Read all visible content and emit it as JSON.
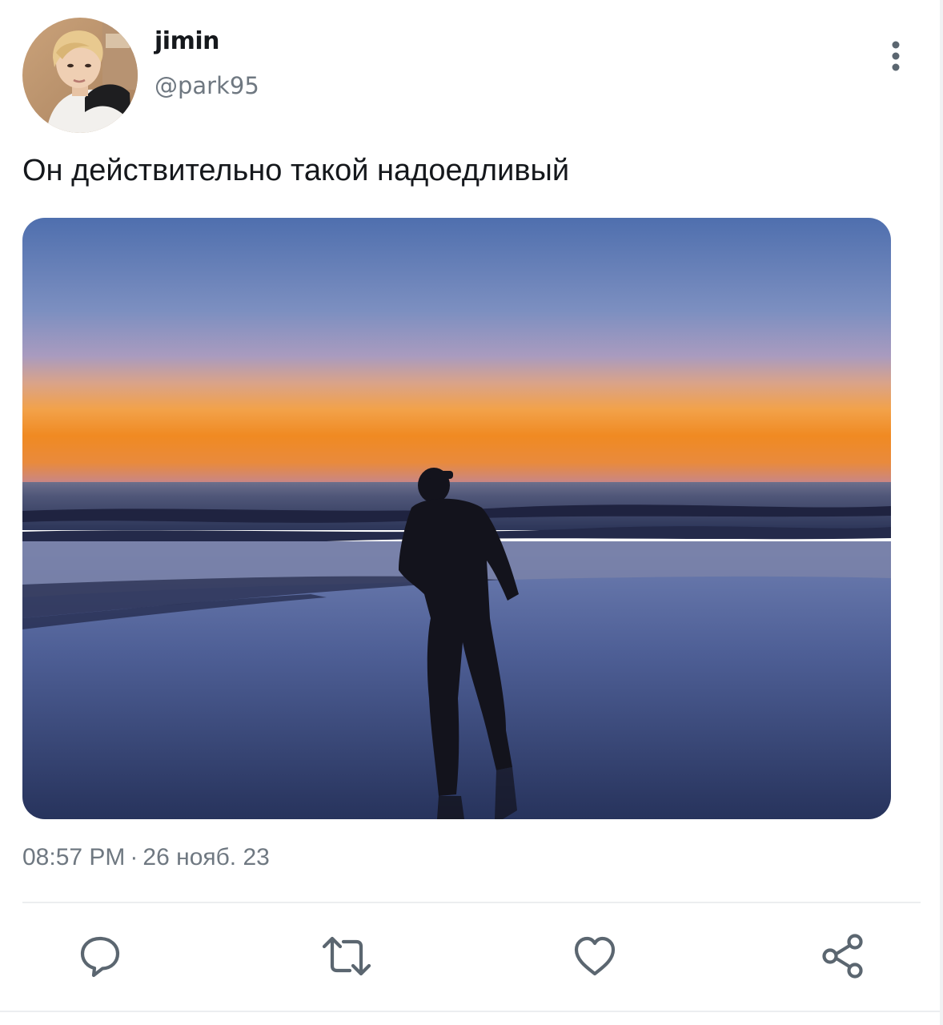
{
  "author": {
    "display_name": "jimin",
    "handle": "@park95"
  },
  "tweet": {
    "text": "Он действительно такой надоедливый",
    "time": "08:57 PM",
    "separator": "·",
    "date": "26 нояб. 23"
  },
  "icons": {
    "more": "more-vertical-icon",
    "reply": "reply-icon",
    "retweet": "retweet-icon",
    "like": "heart-icon",
    "share": "share-icon"
  },
  "colors": {
    "text_primary": "#15181c",
    "text_secondary": "#6f7881",
    "icon": "#5b6670",
    "divider": "#eceef0"
  }
}
